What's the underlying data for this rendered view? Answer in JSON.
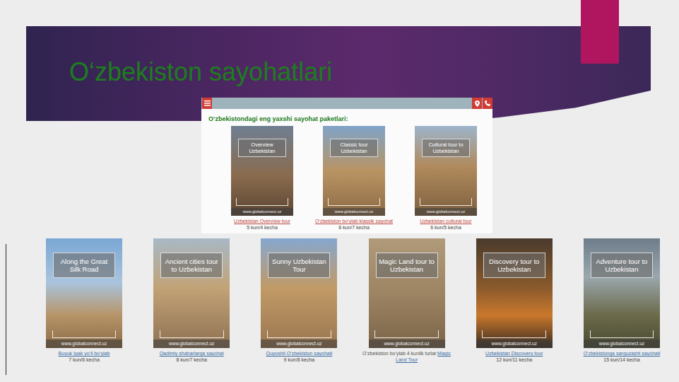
{
  "slide": {
    "title": "O‘zbekiston sayohatlari"
  },
  "site": {
    "section_title": "O‘zbekistondagi eng yaxshi sayohat paketlari:",
    "featured": [
      {
        "poster_title": "Overview Uzbekistan",
        "poster_url": "www.globalconnect.uz",
        "prefix": "",
        "caption": "Uzbekistan Overview tour",
        "duration": "5 kun/4 kecha"
      },
      {
        "poster_title": "Classic tour Uzbekistan",
        "poster_url": "www.globalconnect.uz",
        "prefix": "",
        "caption": "O‘zbekiston bo‘ylab klassik sayohat",
        "duration": "8 kun/7 kecha"
      },
      {
        "poster_title": "Cultural tour to Uzbekistan",
        "poster_url": "www.globalconnect.uz",
        "prefix": "",
        "caption": "Uzbekistan cultural tour",
        "duration": "6 kun/5 kecha"
      }
    ]
  },
  "tours": [
    {
      "poster_title": "Along the Great Silk Road",
      "poster_url": "www.globalconnect.uz",
      "prefix": "",
      "caption": "Buyuk Ipak yo‘li bo‘ylab",
      "duration": "7 kun/6 kecha"
    },
    {
      "poster_title": "Ancient cities tour to Uzbekistan",
      "poster_url": "www.globalconnect.uz",
      "prefix": "",
      "caption": "Qadimiy shaharlarga sayohat",
      "duration": "8 kun/7 kecha"
    },
    {
      "poster_title": "Sunny Uzbekistan Tour",
      "poster_url": "www.globalconnect.uz",
      "prefix": "",
      "caption": "Quyoshli O‘zbekiston sayohati",
      "duration": "9 kun/8 kecha"
    },
    {
      "poster_title": "Magic Land tour to Uzbekistan",
      "poster_url": "www.globalconnect.uz",
      "prefix": "O‘zbekiston bo‘ylab 4 kunlik turlar:",
      "caption": "Magic Land Tour",
      "duration": ""
    },
    {
      "poster_title": "Discovery tour to Uzbekistan",
      "poster_url": "www.globalconnect.uz",
      "prefix": "",
      "caption": "Uzbekistan Discovery tour",
      "duration": "12 kun/11 kecha"
    },
    {
      "poster_title": "Adventure tour to Uzbekistan",
      "poster_url": "www.globalconnect.uz",
      "prefix": "",
      "caption": "O‘zbekistonga sarguzasht sayohati",
      "duration": "15 kun/14 kecha"
    }
  ]
}
